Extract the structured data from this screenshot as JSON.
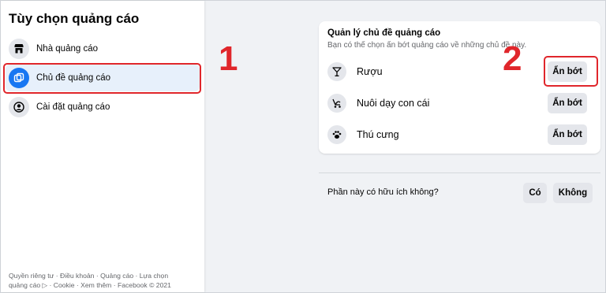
{
  "sidebar": {
    "title": "Tùy chọn quảng cáo",
    "items": [
      {
        "label": "Nhà quảng cáo",
        "icon": "store-icon"
      },
      {
        "label": "Chủ đề quảng cáo",
        "icon": "topics-icon",
        "active": true
      },
      {
        "label": "Cài đặt quảng cáo",
        "icon": "user-circle-icon"
      }
    ],
    "footer": {
      "line1": "Quyền riêng tư · Điều khoản · Quảng cáo · Lựa chọn",
      "line2": "quảng cáo ▷ · Cookie · Xem thêm · Facebook © 2021"
    }
  },
  "annotations": {
    "one": "1",
    "two": "2",
    "color": "#e0262b"
  },
  "card": {
    "title": "Quản lý chủ đề quảng cáo",
    "subtitle": "Bạn có thể chọn ẩn bớt quảng cáo về những chủ đề này.",
    "topics": [
      {
        "label": "Rượu",
        "icon": "cocktail-icon",
        "button": "Ẩn bớt"
      },
      {
        "label": "Nuôi dạy con cái",
        "icon": "stroller-icon",
        "button": "Ẩn bớt"
      },
      {
        "label": "Thú cưng",
        "icon": "paw-icon",
        "button": "Ẩn bớt"
      }
    ]
  },
  "feedback": {
    "question": "Phần này có hữu ích không?",
    "yes": "Có",
    "no": "Không"
  },
  "colors": {
    "accent": "#1877f2",
    "background": "#f0f2f5",
    "highlight": "#e0262b"
  }
}
